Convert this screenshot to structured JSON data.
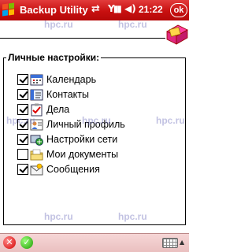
{
  "title_bar": {
    "app_title": "Backup Utility",
    "clock": "21:22",
    "ok_label": "ok"
  },
  "settings": {
    "group_title": "Личные настройки:",
    "items": [
      {
        "label": "Календарь",
        "checked": true,
        "icon": "calendar-icon"
      },
      {
        "label": "Контакты",
        "checked": true,
        "icon": "contacts-icon"
      },
      {
        "label": "Дела",
        "checked": true,
        "icon": "tasks-icon"
      },
      {
        "label": "Личный профиль",
        "checked": true,
        "icon": "profile-icon"
      },
      {
        "label": "Настройки сети",
        "checked": true,
        "icon": "network-settings-icon"
      },
      {
        "label": "Мои документы",
        "checked": false,
        "icon": "my-documents-icon"
      },
      {
        "label": "Сообщения",
        "checked": true,
        "icon": "messages-icon"
      }
    ]
  },
  "watermark": "hpc.ru",
  "bottom_bar": {
    "cancel_icon": "close-icon",
    "accept_icon": "checkmark-icon",
    "input_icon": "keyboard-icon"
  },
  "colors": {
    "title_bar": "#c81010",
    "bottom_bar": "#eac0c0"
  }
}
